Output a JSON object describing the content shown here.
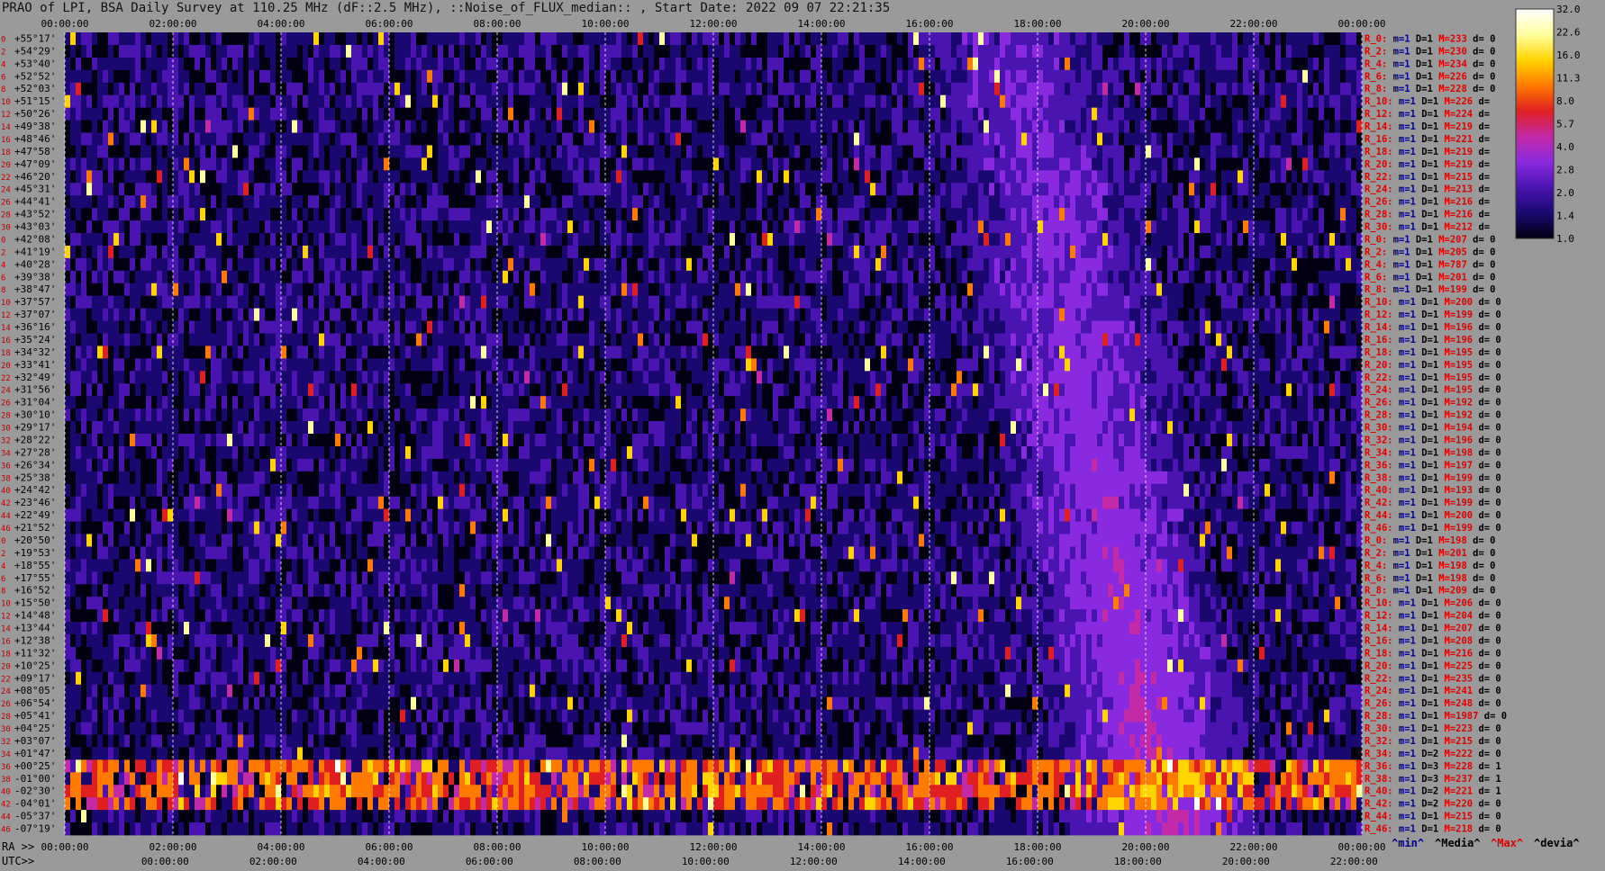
{
  "title": "PRAO of LPI, BSA Daily Survey at 110.25 MHz (dF::2.5 MHz), ::Noise_of_FLUX_median:: , Start Date: 2022 09 07 22:21:35",
  "footer": {
    "ra_prefix": "RA >>",
    "utc_prefix": "UTC>>"
  },
  "legend_keys": [
    {
      "label": "^min^",
      "color": "#00008b"
    },
    {
      "label": "^Media^",
      "color": "#000000"
    },
    {
      "label": "^Max^",
      "color": "#e00000"
    },
    {
      "label": "^devia^",
      "color": "#000000"
    }
  ],
  "colors": {
    "background": "#9a9a9a",
    "scale": [
      "#000010",
      "#1a0870",
      "#4a14b0",
      "#8a2ae0",
      "#c32aa8",
      "#e02020",
      "#ff7a00",
      "#ffd400",
      "#ffffa0",
      "#ffffff"
    ]
  },
  "chart_data": {
    "type": "heatmap",
    "title": "PRAO of LPI, BSA Daily Survey at 110.25 MHz (dF::2.5 MHz), ::Noise_of_FLUX_median::",
    "start_date": "2022 09 07 22:21:35",
    "x_ticks_top": [
      "00:00:00",
      "02:00:00",
      "04:00:00",
      "06:00:00",
      "08:00:00",
      "10:00:00",
      "12:00:00",
      "14:00:00",
      "16:00:00",
      "18:00:00",
      "20:00:00",
      "22:00:00",
      "00:00:00"
    ],
    "x_ticks_ra": [
      "00:00:00",
      "02:00:00",
      "04:00:00",
      "06:00:00",
      "08:00:00",
      "10:00:00",
      "12:00:00",
      "14:00:00",
      "16:00:00",
      "18:00:00",
      "20:00:00",
      "22:00:00",
      "00:00:00"
    ],
    "x_ticks_utc": [
      "00:00:00",
      "02:00:00",
      "04:00:00",
      "06:00:00",
      "08:00:00",
      "10:00:00",
      "12:00:00",
      "14:00:00",
      "16:00:00",
      "18:00:00",
      "20:00:00",
      "22:00:00"
    ],
    "colorbar_ticks": [
      "32.0",
      "22.6",
      "16.0",
      "11.3",
      "8.0",
      "5.7",
      "4.0",
      "2.8",
      "2.0",
      "1.4",
      "1.0"
    ],
    "colorbar_range": [
      1.0,
      32.0
    ],
    "colorbar_scale": "log",
    "rows": [
      {
        "idx": "0",
        "dec": "+55°17'",
        "stat": {
          "r": "R_0:",
          "m": "m=1",
          "D": "D=1",
          "M": "M=233",
          "d": "d= 0"
        }
      },
      {
        "idx": "2",
        "dec": "+54°29'",
        "stat": {
          "r": "R_2:",
          "m": "m=1",
          "D": "D=1",
          "M": "M=230",
          "d": "d= 0"
        }
      },
      {
        "idx": "4",
        "dec": "+53°40'",
        "stat": {
          "r": "R_4:",
          "m": "m=1",
          "D": "D=1",
          "M": "M=234",
          "d": "d= 0"
        }
      },
      {
        "idx": "6",
        "dec": "+52°52'",
        "stat": {
          "r": "R_6:",
          "m": "m=1",
          "D": "D=1",
          "M": "M=226",
          "d": "d= 0"
        }
      },
      {
        "idx": "8",
        "dec": "+52°03'",
        "stat": {
          "r": "R_8:",
          "m": "m=1",
          "D": "D=1",
          "M": "M=228",
          "d": "d= 0"
        }
      },
      {
        "idx": "10",
        "dec": "+51°15'",
        "stat": {
          "r": "R_10:",
          "m": "m=1",
          "D": "D=1",
          "M": "M=226",
          "d": "d="
        }
      },
      {
        "idx": "12",
        "dec": "+50°26'",
        "stat": {
          "r": "R_12:",
          "m": "m=1",
          "D": "D=1",
          "M": "M=224",
          "d": "d="
        }
      },
      {
        "idx": "14",
        "dec": "+49°38'",
        "stat": {
          "r": "R_14:",
          "m": "m=1",
          "D": "D=1",
          "M": "M=219",
          "d": "d="
        }
      },
      {
        "idx": "16",
        "dec": "+48°46'",
        "stat": {
          "r": "R_16:",
          "m": "m=1",
          "D": "D=1",
          "M": "M=221",
          "d": "d="
        }
      },
      {
        "idx": "18",
        "dec": "+47°58'",
        "stat": {
          "r": "R_18:",
          "m": "m=1",
          "D": "D=1",
          "M": "M=219",
          "d": "d="
        }
      },
      {
        "idx": "20",
        "dec": "+47°09'",
        "stat": {
          "r": "R_20:",
          "m": "m=1",
          "D": "D=1",
          "M": "M=219",
          "d": "d="
        }
      },
      {
        "idx": "22",
        "dec": "+46°20'",
        "stat": {
          "r": "R_22:",
          "m": "m=1",
          "D": "D=1",
          "M": "M=215",
          "d": "d="
        }
      },
      {
        "idx": "24",
        "dec": "+45°31'",
        "stat": {
          "r": "R_24:",
          "m": "m=1",
          "D": "D=1",
          "M": "M=213",
          "d": "d="
        }
      },
      {
        "idx": "26",
        "dec": "+44°41'",
        "stat": {
          "r": "R_26:",
          "m": "m=1",
          "D": "D=1",
          "M": "M=216",
          "d": "d="
        }
      },
      {
        "idx": "28",
        "dec": "+43°52'",
        "stat": {
          "r": "R_28:",
          "m": "m=1",
          "D": "D=1",
          "M": "M=216",
          "d": "d="
        }
      },
      {
        "idx": "30",
        "dec": "+43°03'",
        "stat": {
          "r": "R_30:",
          "m": "m=1",
          "D": "D=1",
          "M": "M=212",
          "d": "d="
        }
      },
      {
        "idx": "0",
        "dec": "+42°08'",
        "stat": {
          "r": "R_0:",
          "m": "m=1",
          "D": "D=1",
          "M": "M=207",
          "d": "d= 0"
        }
      },
      {
        "idx": "2",
        "dec": "+41°19'",
        "stat": {
          "r": "R_2:",
          "m": "m=1",
          "D": "D=1",
          "M": "M=205",
          "d": "d= 0"
        }
      },
      {
        "idx": "4",
        "dec": "+40°28'",
        "stat": {
          "r": "R_4:",
          "m": "m=1",
          "D": "D=1",
          "M": "M=787",
          "d": "d= 0"
        }
      },
      {
        "idx": "6",
        "dec": "+39°38'",
        "stat": {
          "r": "R_6:",
          "m": "m=1",
          "D": "D=1",
          "M": "M=201",
          "d": "d= 0"
        }
      },
      {
        "idx": "8",
        "dec": "+38°47'",
        "stat": {
          "r": "R_8:",
          "m": "m=1",
          "D": "D=1",
          "M": "M=199",
          "d": "d= 0"
        }
      },
      {
        "idx": "10",
        "dec": "+37°57'",
        "stat": {
          "r": "R_10:",
          "m": "m=1",
          "D": "D=1",
          "M": "M=200",
          "d": "d= 0"
        }
      },
      {
        "idx": "12",
        "dec": "+37°07'",
        "stat": {
          "r": "R_12:",
          "m": "m=1",
          "D": "D=1",
          "M": "M=199",
          "d": "d= 0"
        }
      },
      {
        "idx": "14",
        "dec": "+36°16'",
        "stat": {
          "r": "R_14:",
          "m": "m=1",
          "D": "D=1",
          "M": "M=196",
          "d": "d= 0"
        }
      },
      {
        "idx": "16",
        "dec": "+35°24'",
        "stat": {
          "r": "R_16:",
          "m": "m=1",
          "D": "D=1",
          "M": "M=196",
          "d": "d= 0"
        }
      },
      {
        "idx": "18",
        "dec": "+34°32'",
        "stat": {
          "r": "R_18:",
          "m": "m=1",
          "D": "D=1",
          "M": "M=195",
          "d": "d= 0"
        }
      },
      {
        "idx": "20",
        "dec": "+33°41'",
        "stat": {
          "r": "R_20:",
          "m": "m=1",
          "D": "D=1",
          "M": "M=195",
          "d": "d= 0"
        }
      },
      {
        "idx": "22",
        "dec": "+32°49'",
        "stat": {
          "r": "R_22:",
          "m": "m=1",
          "D": "D=1",
          "M": "M=195",
          "d": "d= 0"
        }
      },
      {
        "idx": "24",
        "dec": "+31°56'",
        "stat": {
          "r": "R_24:",
          "m": "m=1",
          "D": "D=1",
          "M": "M=195",
          "d": "d= 0"
        }
      },
      {
        "idx": "26",
        "dec": "+31°04'",
        "stat": {
          "r": "R_26:",
          "m": "m=1",
          "D": "D=1",
          "M": "M=192",
          "d": "d= 0"
        }
      },
      {
        "idx": "28",
        "dec": "+30°10'",
        "stat": {
          "r": "R_28:",
          "m": "m=1",
          "D": "D=1",
          "M": "M=192",
          "d": "d= 0"
        }
      },
      {
        "idx": "30",
        "dec": "+29°17'",
        "stat": {
          "r": "R_30:",
          "m": "m=1",
          "D": "D=1",
          "M": "M=194",
          "d": "d= 0"
        }
      },
      {
        "idx": "32",
        "dec": "+28°22'",
        "stat": {
          "r": "R_32:",
          "m": "m=1",
          "D": "D=1",
          "M": "M=196",
          "d": "d= 0"
        }
      },
      {
        "idx": "34",
        "dec": "+27°28'",
        "stat": {
          "r": "R_34:",
          "m": "m=1",
          "D": "D=1",
          "M": "M=198",
          "d": "d= 0"
        }
      },
      {
        "idx": "36",
        "dec": "+26°34'",
        "stat": {
          "r": "R_36:",
          "m": "m=1",
          "D": "D=1",
          "M": "M=197",
          "d": "d= 0"
        }
      },
      {
        "idx": "38",
        "dec": "+25°38'",
        "stat": {
          "r": "R_38:",
          "m": "m=1",
          "D": "D=1",
          "M": "M=199",
          "d": "d= 0"
        }
      },
      {
        "idx": "40",
        "dec": "+24°42'",
        "stat": {
          "r": "R_40:",
          "m": "m=1",
          "D": "D=1",
          "M": "M=193",
          "d": "d= 0"
        }
      },
      {
        "idx": "42",
        "dec": "+23°46'",
        "stat": {
          "r": "R_42:",
          "m": "m=1",
          "D": "D=1",
          "M": "M=199",
          "d": "d= 0"
        }
      },
      {
        "idx": "44",
        "dec": "+22°49'",
        "stat": {
          "r": "R_44:",
          "m": "m=1",
          "D": "D=1",
          "M": "M=200",
          "d": "d= 0"
        }
      },
      {
        "idx": "46",
        "dec": "+21°52'",
        "stat": {
          "r": "R_46:",
          "m": "m=1",
          "D": "D=1",
          "M": "M=199",
          "d": "d= 0"
        }
      },
      {
        "idx": "0",
        "dec": "+20°50'",
        "stat": {
          "r": "R_0:",
          "m": "m=1",
          "D": "D=1",
          "M": "M=198",
          "d": "d= 0"
        }
      },
      {
        "idx": "2",
        "dec": "+19°53'",
        "stat": {
          "r": "R_2:",
          "m": "m=1",
          "D": "D=1",
          "M": "M=201",
          "d": "d= 0"
        }
      },
      {
        "idx": "4",
        "dec": "+18°55'",
        "stat": {
          "r": "R_4:",
          "m": "m=1",
          "D": "D=1",
          "M": "M=198",
          "d": "d= 0"
        }
      },
      {
        "idx": "6",
        "dec": "+17°55'",
        "stat": {
          "r": "R_6:",
          "m": "m=1",
          "D": "D=1",
          "M": "M=198",
          "d": "d= 0"
        }
      },
      {
        "idx": "8",
        "dec": "+16°52'",
        "stat": {
          "r": "R_8:",
          "m": "m=1",
          "D": "D=1",
          "M": "M=209",
          "d": "d= 0"
        }
      },
      {
        "idx": "10",
        "dec": "+15°50'",
        "stat": {
          "r": "R_10:",
          "m": "m=1",
          "D": "D=1",
          "M": "M=206",
          "d": "d= 0"
        }
      },
      {
        "idx": "12",
        "dec": "+14°48'",
        "stat": {
          "r": "R_12:",
          "m": "m=1",
          "D": "D=1",
          "M": "M=204",
          "d": "d= 0"
        }
      },
      {
        "idx": "14",
        "dec": "+13°44'",
        "stat": {
          "r": "R_14:",
          "m": "m=1",
          "D": "D=1",
          "M": "M=207",
          "d": "d= 0"
        }
      },
      {
        "idx": "16",
        "dec": "+12°38'",
        "stat": {
          "r": "R_16:",
          "m": "m=1",
          "D": "D=1",
          "M": "M=208",
          "d": "d= 0"
        }
      },
      {
        "idx": "18",
        "dec": "+11°32'",
        "stat": {
          "r": "R_18:",
          "m": "m=1",
          "D": "D=1",
          "M": "M=216",
          "d": "d= 0"
        }
      },
      {
        "idx": "20",
        "dec": "+10°25'",
        "stat": {
          "r": "R_20:",
          "m": "m=1",
          "D": "D=1",
          "M": "M=225",
          "d": "d= 0"
        }
      },
      {
        "idx": "22",
        "dec": "+09°17'",
        "stat": {
          "r": "R_22:",
          "m": "m=1",
          "D": "D=1",
          "M": "M=235",
          "d": "d= 0"
        }
      },
      {
        "idx": "24",
        "dec": "+08°05'",
        "stat": {
          "r": "R_24:",
          "m": "m=1",
          "D": "D=1",
          "M": "M=241",
          "d": "d= 0"
        }
      },
      {
        "idx": "26",
        "dec": "+06°54'",
        "stat": {
          "r": "R_26:",
          "m": "m=1",
          "D": "D=1",
          "M": "M=248",
          "d": "d= 0"
        }
      },
      {
        "idx": "28",
        "dec": "+05°41'",
        "stat": {
          "r": "R_28:",
          "m": "m=1",
          "D": "D=1",
          "M": "M=1987",
          "d": "d= 0"
        }
      },
      {
        "idx": "30",
        "dec": "+04°25'",
        "stat": {
          "r": "R_30:",
          "m": "m=1",
          "D": "D=1",
          "M": "M=223",
          "d": "d= 0"
        }
      },
      {
        "idx": "32",
        "dec": "+03°07'",
        "stat": {
          "r": "R_32:",
          "m": "m=1",
          "D": "D=1",
          "M": "M=215",
          "d": "d= 0"
        }
      },
      {
        "idx": "34",
        "dec": "+01°47'",
        "stat": {
          "r": "R_34:",
          "m": "m=1",
          "D": "D=2",
          "M": "M=222",
          "d": "d= 0"
        }
      },
      {
        "idx": "36",
        "dec": "+00°25'",
        "stat": {
          "r": "R_36:",
          "m": "m=1",
          "D": "D=3",
          "M": "M=228",
          "d": "d= 1"
        }
      },
      {
        "idx": "38",
        "dec": "-01°00'",
        "stat": {
          "r": "R_38:",
          "m": "m=1",
          "D": "D=3",
          "M": "M=237",
          "d": "d= 1"
        }
      },
      {
        "idx": "40",
        "dec": "-02°30'",
        "stat": {
          "r": "R_40:",
          "m": "m=1",
          "D": "D=2",
          "M": "M=221",
          "d": "d= 1"
        }
      },
      {
        "idx": "42",
        "dec": "-04°01'",
        "stat": {
          "r": "R_42:",
          "m": "m=1",
          "D": "D=2",
          "M": "M=220",
          "d": "d= 0"
        }
      },
      {
        "idx": "44",
        "dec": "-05°37'",
        "stat": {
          "r": "R_44:",
          "m": "m=1",
          "D": "D=1",
          "M": "M=215",
          "d": "d= 0"
        }
      },
      {
        "idx": "46",
        "dec": "-07°19'",
        "stat": {
          "r": "R_46:",
          "m": "m=1",
          "D": "D=1",
          "M": "M=218",
          "d": "d= 0"
        }
      }
    ]
  }
}
